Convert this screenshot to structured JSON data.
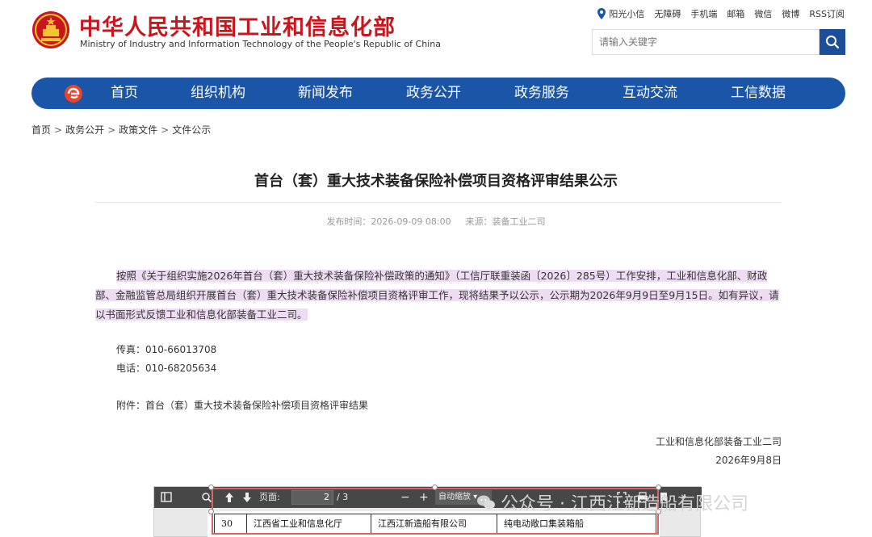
{
  "header": {
    "title": "中华人民共和国工业和信息化部",
    "subtitle": "Ministry of Industry and Information Technology of the People's Republic of China",
    "toplinks": [
      "阳光小信",
      "无障碍",
      "手机端",
      "邮箱",
      "微信",
      "微博",
      "RSS订阅"
    ],
    "search_placeholder": "请输入关键字"
  },
  "nav": {
    "items": [
      "首页",
      "组织机构",
      "新闻发布",
      "政务公开",
      "政务服务",
      "互动交流",
      "工信数据"
    ]
  },
  "breadcrumb": [
    "首页",
    "政务公开",
    "政策文件",
    "文件公示"
  ],
  "article": {
    "title": "首台（套）重大技术装备保险补偿项目资格评审结果公示",
    "publish_label": "发布时间：",
    "publish_time": "2026-09-09 08:00",
    "source_label": "来源：",
    "source": "装备工业二司",
    "paragraph": "按照《关于组织实施2026年首台（套）重大技术装备保险补偿政策的通知》（工信厅联重装函〔2026〕285号）工作安排，工业和信息化部、财政部、金融监管总局组织开展首台（套）重大技术装备保险补偿项目资格评审工作，现将结果予以公示，公示期为2026年9月9日至9月15日。如有异议，请以书面形式反馈工业和信息化部装备工业二司。",
    "fax": "传真：010-66013708",
    "phone": "电话：010-68205634",
    "attachment": "附件：首台（套）重大技术装备保险补偿项目资格评审结果",
    "signature": "工业和信息化部装备工业二司",
    "date": "2026年9月8日"
  },
  "pdf_viewer": {
    "page_label": "页面:",
    "current_page": "2",
    "total_pages": "/ 3",
    "zoom": "自动缩放",
    "row": [
      "30",
      "江西省工业和信息化厅",
      "江西江新造船有限公司",
      "纯电动敞口集装箱船"
    ]
  },
  "watermark": "公众号 · 江西江新造船有限公司",
  "colors": {
    "brand_red": "#c8161d",
    "nav_blue": "#1b55a8",
    "highlight": "#eedcf2"
  }
}
